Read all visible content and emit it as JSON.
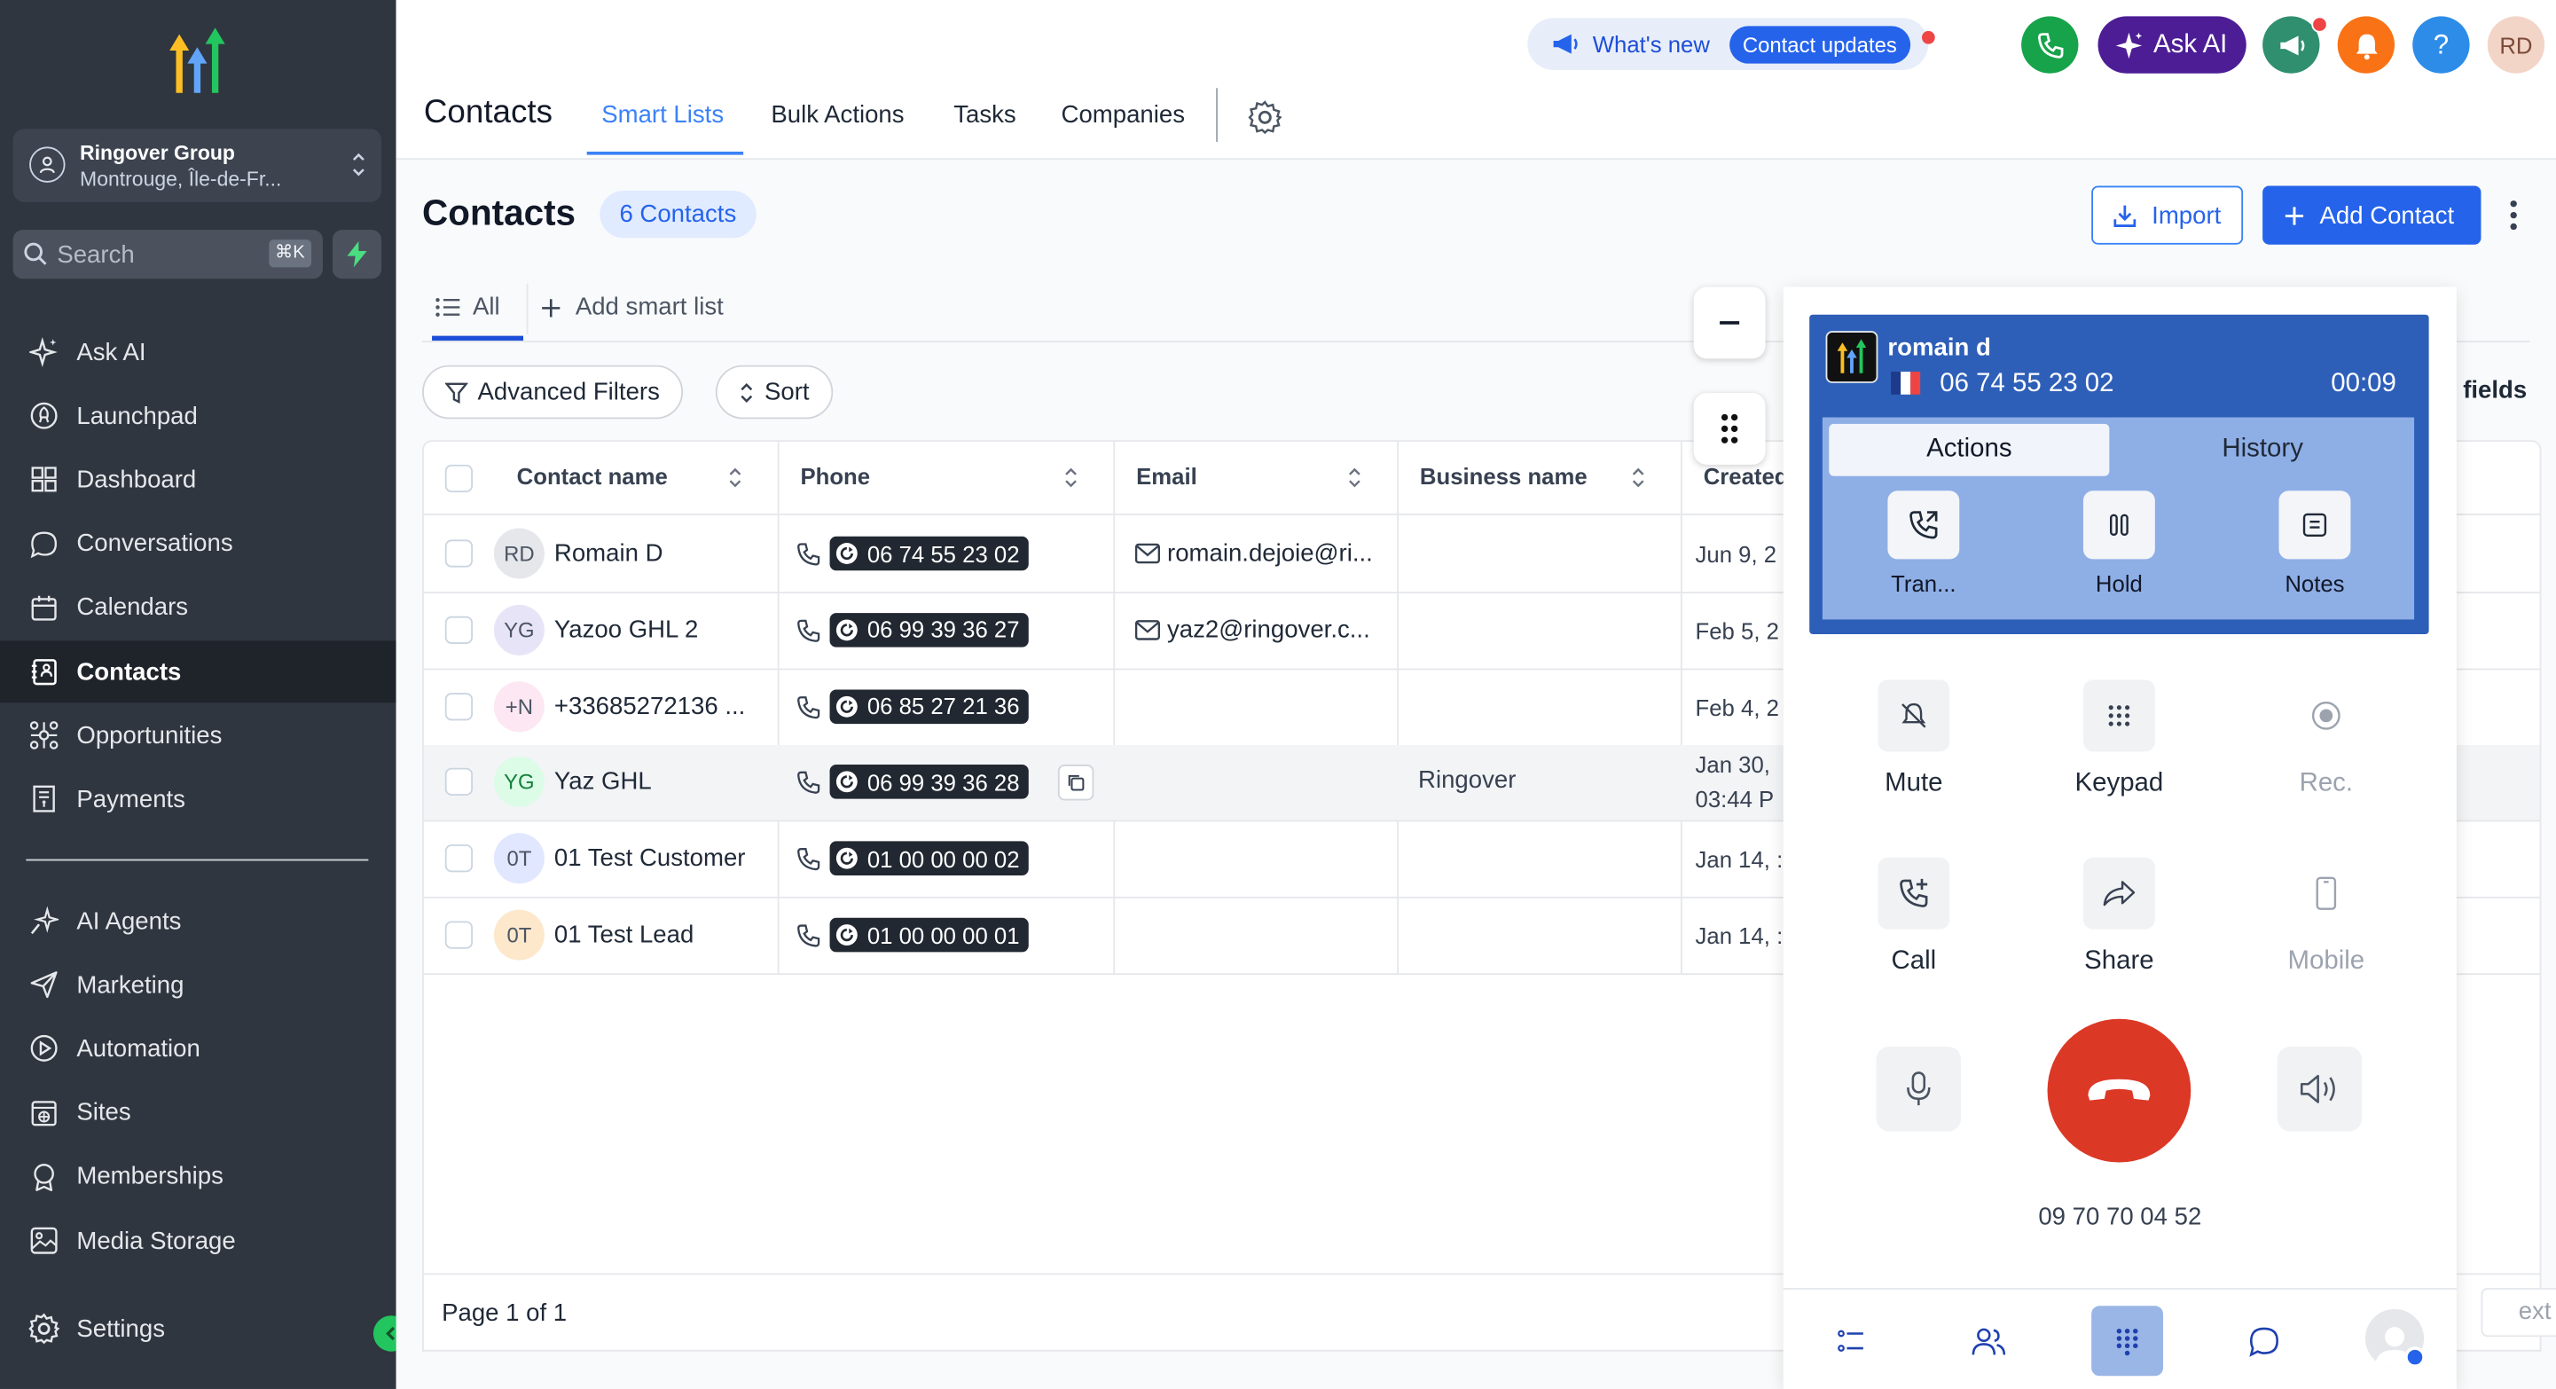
{
  "sidebar": {
    "account": {
      "name": "Ringover Group",
      "location": "Montrouge, Île-de-Fr..."
    },
    "search": {
      "placeholder": "Search",
      "shortcut": "⌘K"
    },
    "items": [
      {
        "label": "Ask AI",
        "icon": "sparkle-icon"
      },
      {
        "label": "Launchpad",
        "icon": "rocket-icon"
      },
      {
        "label": "Dashboard",
        "icon": "dashboard-icon"
      },
      {
        "label": "Conversations",
        "icon": "chat-bubble-icon"
      },
      {
        "label": "Calendars",
        "icon": "calendar-icon"
      },
      {
        "label": "Contacts",
        "icon": "contacts-icon",
        "active": true
      },
      {
        "label": "Opportunities",
        "icon": "opportunities-icon"
      },
      {
        "label": "Payments",
        "icon": "receipt-icon"
      }
    ],
    "items2": [
      {
        "label": "AI Agents",
        "icon": "ai-agent-icon"
      },
      {
        "label": "Marketing",
        "icon": "send-icon"
      },
      {
        "label": "Automation",
        "icon": "automation-icon"
      },
      {
        "label": "Sites",
        "icon": "sites-icon"
      },
      {
        "label": "Memberships",
        "icon": "badge-icon"
      },
      {
        "label": "Media Storage",
        "icon": "image-icon"
      }
    ],
    "settings_label": "Settings"
  },
  "topbar": {
    "title": "Contacts",
    "tabs": [
      "Smart Lists",
      "Bulk Actions",
      "Tasks",
      "Companies"
    ],
    "active_tab": "Smart Lists",
    "whats_new": "What's new",
    "contact_updates": "Contact updates",
    "ask_ai": "Ask AI",
    "user_initials": "RD",
    "help": "?"
  },
  "page": {
    "title": "Contacts",
    "count_label": "6 Contacts",
    "import_label": "Import",
    "add_label": "Add Contact",
    "smart_all": "All",
    "add_smart_list": "Add smart list",
    "advanced_filters": "Advanced Filters",
    "sort": "Sort",
    "fields_label": "fields"
  },
  "table": {
    "columns": [
      "Contact name",
      "Phone",
      "Email",
      "Business name",
      "Created"
    ],
    "rows": [
      {
        "initials": "RD",
        "name": "Romain D",
        "phone": "06 74 55 23 02",
        "email": "romain.dejoie@ri...",
        "business": "",
        "date": "Jun 9, 2",
        "date2": ""
      },
      {
        "initials": "YG",
        "name": "Yazoo GHL 2",
        "phone": "06 99 39 36 27",
        "email": "yaz2@ringover.c...",
        "business": "",
        "date": "Feb 5, 2",
        "date2": ""
      },
      {
        "initials": "+N",
        "name": "+33685272136 ...",
        "phone": "06 85 27 21 36",
        "email": "",
        "business": "",
        "date": "Feb 4, 2",
        "date2": ""
      },
      {
        "initials": "YG",
        "name": "Yaz GHL",
        "phone": "06 99 39 36 28",
        "email": "",
        "business": "Ringover",
        "date": "Jan 30,",
        "date2": "03:44 P"
      },
      {
        "initials": "0T",
        "name": "01 Test Customer",
        "phone": "01 00 00 00 02",
        "email": "",
        "business": "",
        "date": "Jan 14, :",
        "date2": ""
      },
      {
        "initials": "0T",
        "name": "01 Test Lead",
        "phone": "01 00 00 00 01",
        "email": "",
        "business": "",
        "date": "Jan 14, :",
        "date2": ""
      }
    ],
    "pagination": "Page 1 of 1",
    "next": "ext"
  },
  "dialer": {
    "caller_name": "romain d",
    "caller_number": "06 74 55 23 02",
    "timer": "00:09",
    "seg_actions": "Actions",
    "seg_history": "History",
    "actions": [
      "Tran...",
      "Hold",
      "Notes"
    ],
    "controls": [
      "Mute",
      "Keypad",
      "Rec.",
      "Call",
      "Share",
      "Mobile"
    ],
    "line_number": "09 70 70 04 52"
  },
  "colors": {
    "sidebar_bg": "#30363f",
    "accent": "#2563eb",
    "hangup": "#dc3826",
    "call_card": "#2e5fb8"
  }
}
